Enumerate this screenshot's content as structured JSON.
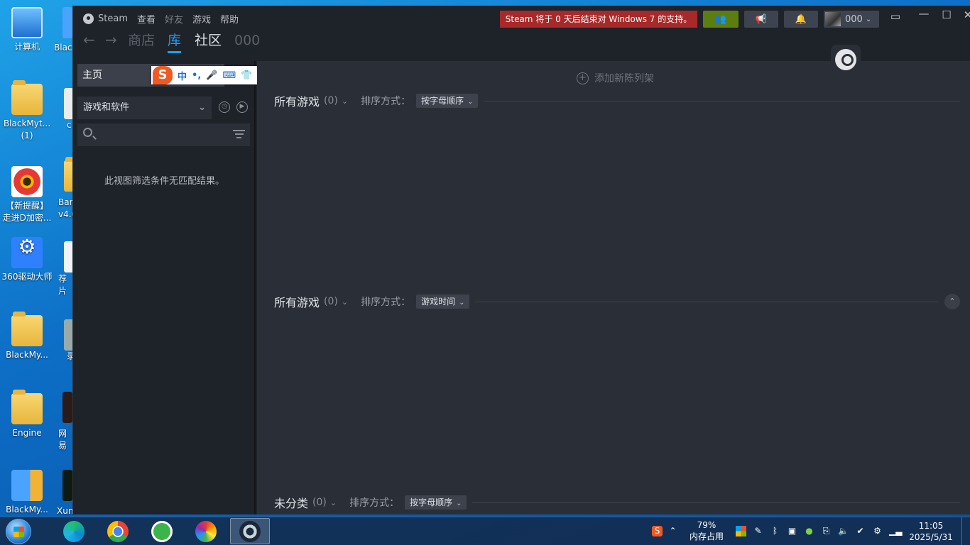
{
  "desktop": {
    "icons": [
      {
        "label": "计算机"
      },
      {
        "label": "BlackMyt...\n(1)"
      },
      {
        "label": "【新提醒】\n走进D加密..."
      },
      {
        "label": "360驱动大师"
      },
      {
        "label": "BlackMy..."
      },
      {
        "label": "Engine"
      },
      {
        "label": "BlackMy..."
      }
    ],
    "peek_labels": [
      "Blac",
      "c",
      "Bar\nv4.6",
      "荐片",
      "录",
      "网易",
      "Xun"
    ]
  },
  "steam": {
    "title_menu": {
      "app": "Steam",
      "view": "查看",
      "friends": "好友",
      "games": "游戏",
      "help": "帮助"
    },
    "notice": "Steam 将于 0 天后结束对 Windows 7 的支持。",
    "user_name": "000",
    "nav": {
      "back": "←",
      "forward": "→",
      "store": "商店",
      "library": "库",
      "community": "社区",
      "user": "000"
    },
    "sidebar": {
      "home": "主页",
      "filter": "游戏和软件",
      "search_placeholder": "",
      "empty_message": "此视图筛选条件无匹配结果。"
    },
    "ime": {
      "logo": "S",
      "items": [
        "中",
        "•,",
        "🎤",
        "⌨",
        "👕",
        "⊞",
        "🛠"
      ]
    },
    "main": {
      "add_shelf": "添加新陈列架",
      "shelves": [
        {
          "title": "所有游戏",
          "count": "(0)",
          "sort_label": "排序方式：",
          "sort_value": "按字母顺序"
        },
        {
          "title": "所有游戏",
          "count": "(0)",
          "sort_label": "排序方式：",
          "sort_value": "游戏时间"
        },
        {
          "title": "未分类",
          "count": "(0)",
          "sort_label": "排序方式：",
          "sort_value": "按字母顺序"
        }
      ]
    }
  },
  "taskbar": {
    "memory_percent": "79%",
    "memory_label": "内存占用",
    "time": "11:05",
    "date": "2025/5/31"
  },
  "colors": {
    "steam_bg": "#1e2229",
    "main_bg": "#2a2e36",
    "accent": "#1a9fff",
    "notice": "#a82929",
    "friends": "#5c7e10"
  }
}
